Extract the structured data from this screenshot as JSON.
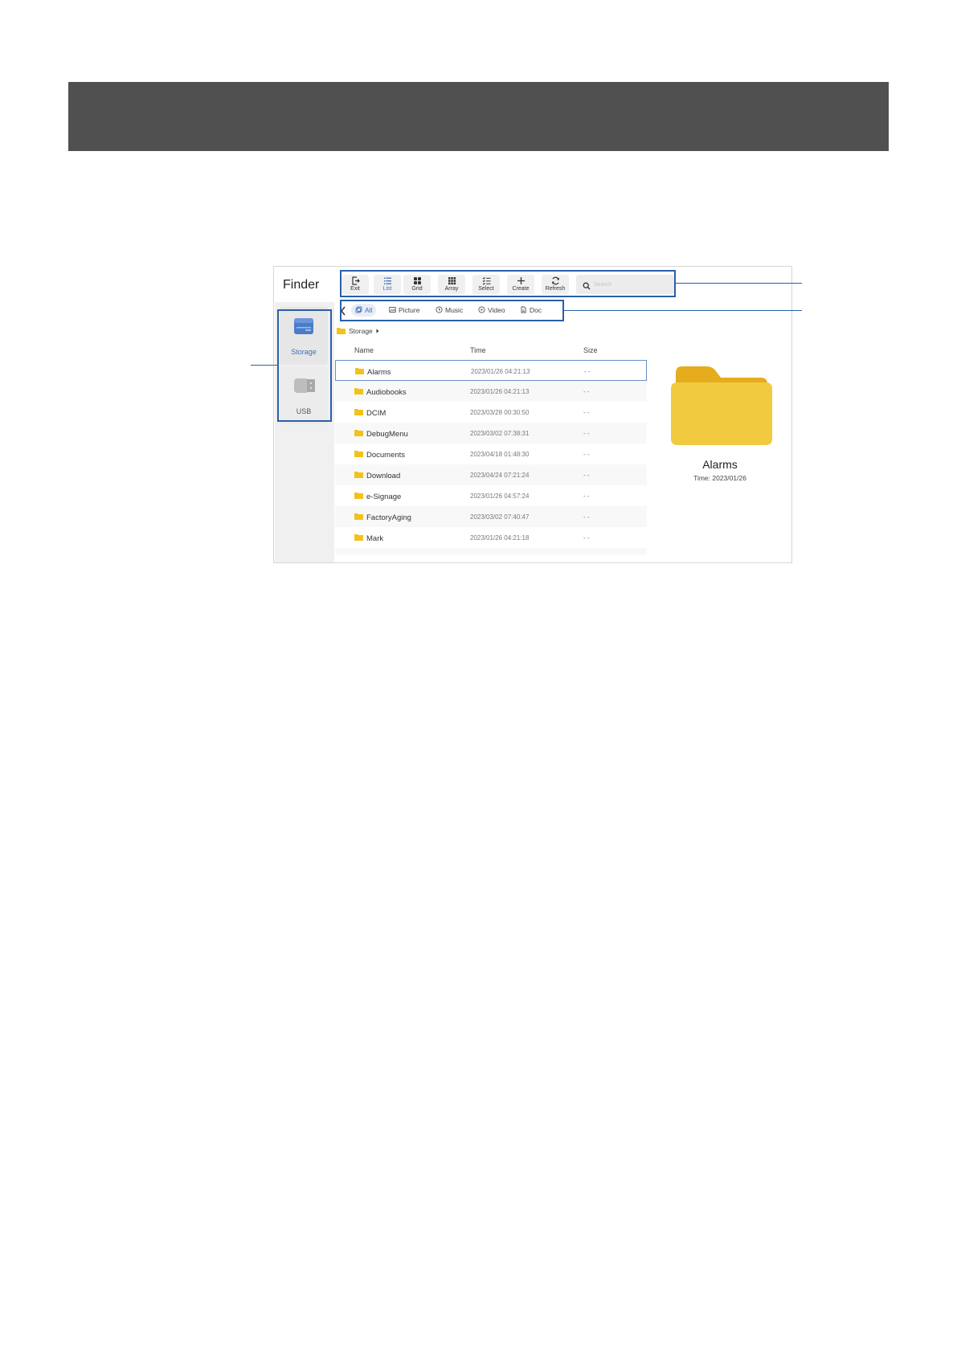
{
  "app": {
    "title": "Finder"
  },
  "sidebar": {
    "items": [
      {
        "label": "Storage",
        "active": true
      },
      {
        "label": "USB",
        "active": false
      }
    ]
  },
  "toolbar": {
    "buttons": [
      {
        "label": "Exit",
        "icon": "exit-icon"
      },
      {
        "label": "List",
        "icon": "list-icon",
        "active": true
      },
      {
        "label": "Grid",
        "icon": "grid-icon"
      },
      {
        "label": "Array",
        "icon": "array-icon"
      },
      {
        "label": "Select",
        "icon": "select-icon"
      },
      {
        "label": "Create",
        "icon": "plus-icon"
      },
      {
        "label": "Refresh",
        "icon": "refresh-icon"
      }
    ],
    "search_placeholder": "Search"
  },
  "filters": [
    {
      "label": "All",
      "icon": "all-icon",
      "active": true
    },
    {
      "label": "Picture",
      "icon": "picture-icon"
    },
    {
      "label": "Music",
      "icon": "music-icon"
    },
    {
      "label": "Video",
      "icon": "video-icon"
    },
    {
      "label": "Doc",
      "icon": "doc-icon"
    }
  ],
  "breadcrumb": {
    "path": "Storage"
  },
  "table": {
    "columns": [
      "Name",
      "Time",
      "Size"
    ],
    "rows": [
      {
        "name": "Alarms",
        "time": "2023/01/26 04:21:13",
        "size": "- -"
      },
      {
        "name": "Audiobooks",
        "time": "2023/01/26 04:21:13",
        "size": "- -"
      },
      {
        "name": "DCIM",
        "time": "2023/03/28 00:30:50",
        "size": "- -"
      },
      {
        "name": "DebugMenu",
        "time": "2023/03/02 07:38:31",
        "size": "- -"
      },
      {
        "name": "Documents",
        "time": "2023/04/18 01:48:30",
        "size": "- -"
      },
      {
        "name": "Download",
        "time": "2023/04/24 07:21:24",
        "size": "- -"
      },
      {
        "name": "e-Signage",
        "time": "2023/01/26 04:57:24",
        "size": "- -"
      },
      {
        "name": "FactoryAging",
        "time": "2023/03/02 07:40:47",
        "size": "- -"
      },
      {
        "name": "Mark",
        "time": "2023/01/26 04:21:18",
        "size": "- -"
      }
    ]
  },
  "preview": {
    "name": "Alarms",
    "time": "Time: 2023/01/26"
  },
  "colors": {
    "banner": "#505050",
    "accent": "#3e6fb8",
    "callout": "#2a5fa8",
    "folder": "#f2c21b"
  }
}
